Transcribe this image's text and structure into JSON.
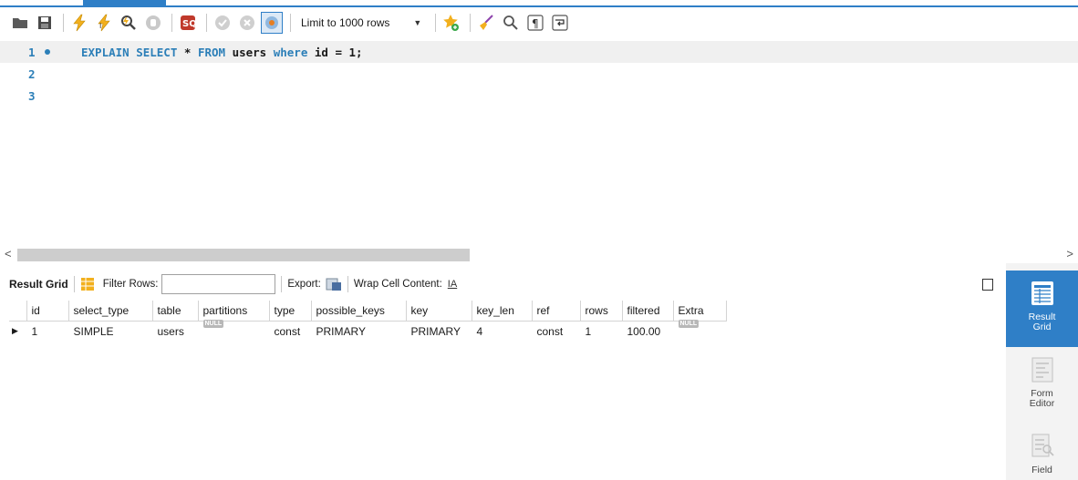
{
  "toolbar": {
    "limit_label": "Limit to 1000 rows",
    "icons": [
      "open-folder-icon",
      "save-icon",
      "execute-lightning-icon",
      "execute-cursor-icon",
      "explain-magnifier-icon",
      "stop-icon",
      "toggle-autocommit-icon",
      "commit-icon",
      "rollback-icon",
      "toggle-continue-on-error-icon",
      "add-favorite-icon",
      "beautify-broom-icon",
      "find-icon",
      "invisible-chars-icon",
      "word-wrap-icon"
    ]
  },
  "editor": {
    "lines": [
      {
        "number": "1",
        "kw1": "EXPLAIN SELECT",
        "sep1": " * ",
        "kw2": "FROM",
        "sep2": " users ",
        "kw3": "where",
        "sep3": " id = 1;"
      },
      {
        "number": "2"
      },
      {
        "number": "3"
      }
    ]
  },
  "result_toolbar": {
    "result_grid": "Result Grid",
    "filter_rows": "Filter Rows:",
    "export": "Export:",
    "wrap_cell": "Wrap Cell Content:"
  },
  "grid": {
    "columns": [
      "id",
      "select_type",
      "table",
      "partitions",
      "type",
      "possible_keys",
      "key",
      "key_len",
      "ref",
      "rows",
      "filtered",
      "Extra"
    ],
    "rows": [
      [
        "1",
        "SIMPLE",
        "users",
        "NULL",
        "const",
        "PRIMARY",
        "PRIMARY",
        "4",
        "const",
        "1",
        "100.00",
        "NULL"
      ]
    ]
  },
  "side_panel": {
    "result_grid": "Result Grid",
    "form_editor": "Form Editor",
    "field": "Field"
  },
  "colors": {
    "accent": "#2f7fc7",
    "keyword": "#2c7fb8",
    "null_badge": "#b8b8b8"
  }
}
